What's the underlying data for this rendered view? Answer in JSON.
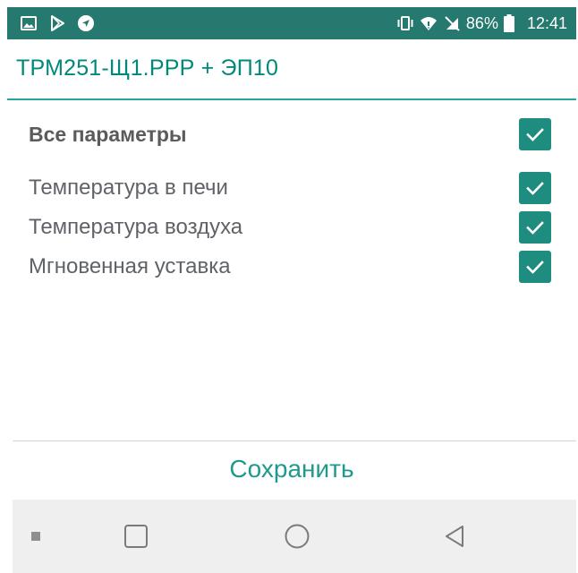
{
  "status_bar": {
    "icons_left": [
      "image-icon",
      "play-store-icon",
      "navigation-icon"
    ],
    "icons_right": [
      "vibrate-icon",
      "wifi-icon",
      "no-sim-icon",
      "battery-icon"
    ],
    "battery_percent": "86%",
    "time": "12:41"
  },
  "header": {
    "title": "ТРМ251-Щ1.РРР + ЭП10"
  },
  "parameters": {
    "all_label": "Все параметры",
    "all_checked": true,
    "items": [
      {
        "label": "Температура в печи",
        "checked": true
      },
      {
        "label": "Температура воздуха",
        "checked": true
      },
      {
        "label": "Мгновенная уставка",
        "checked": true
      }
    ]
  },
  "footer": {
    "save_label": "Сохранить"
  },
  "nav_bar": {
    "buttons": [
      "menu-dot-icon",
      "recents-square-icon",
      "home-circle-icon",
      "back-triangle-icon"
    ]
  },
  "colors": {
    "status_bar": "#26796F",
    "accent": "#00897B",
    "checkbox": "#1E8C7E",
    "nav_bar": "#EFEFEF"
  }
}
